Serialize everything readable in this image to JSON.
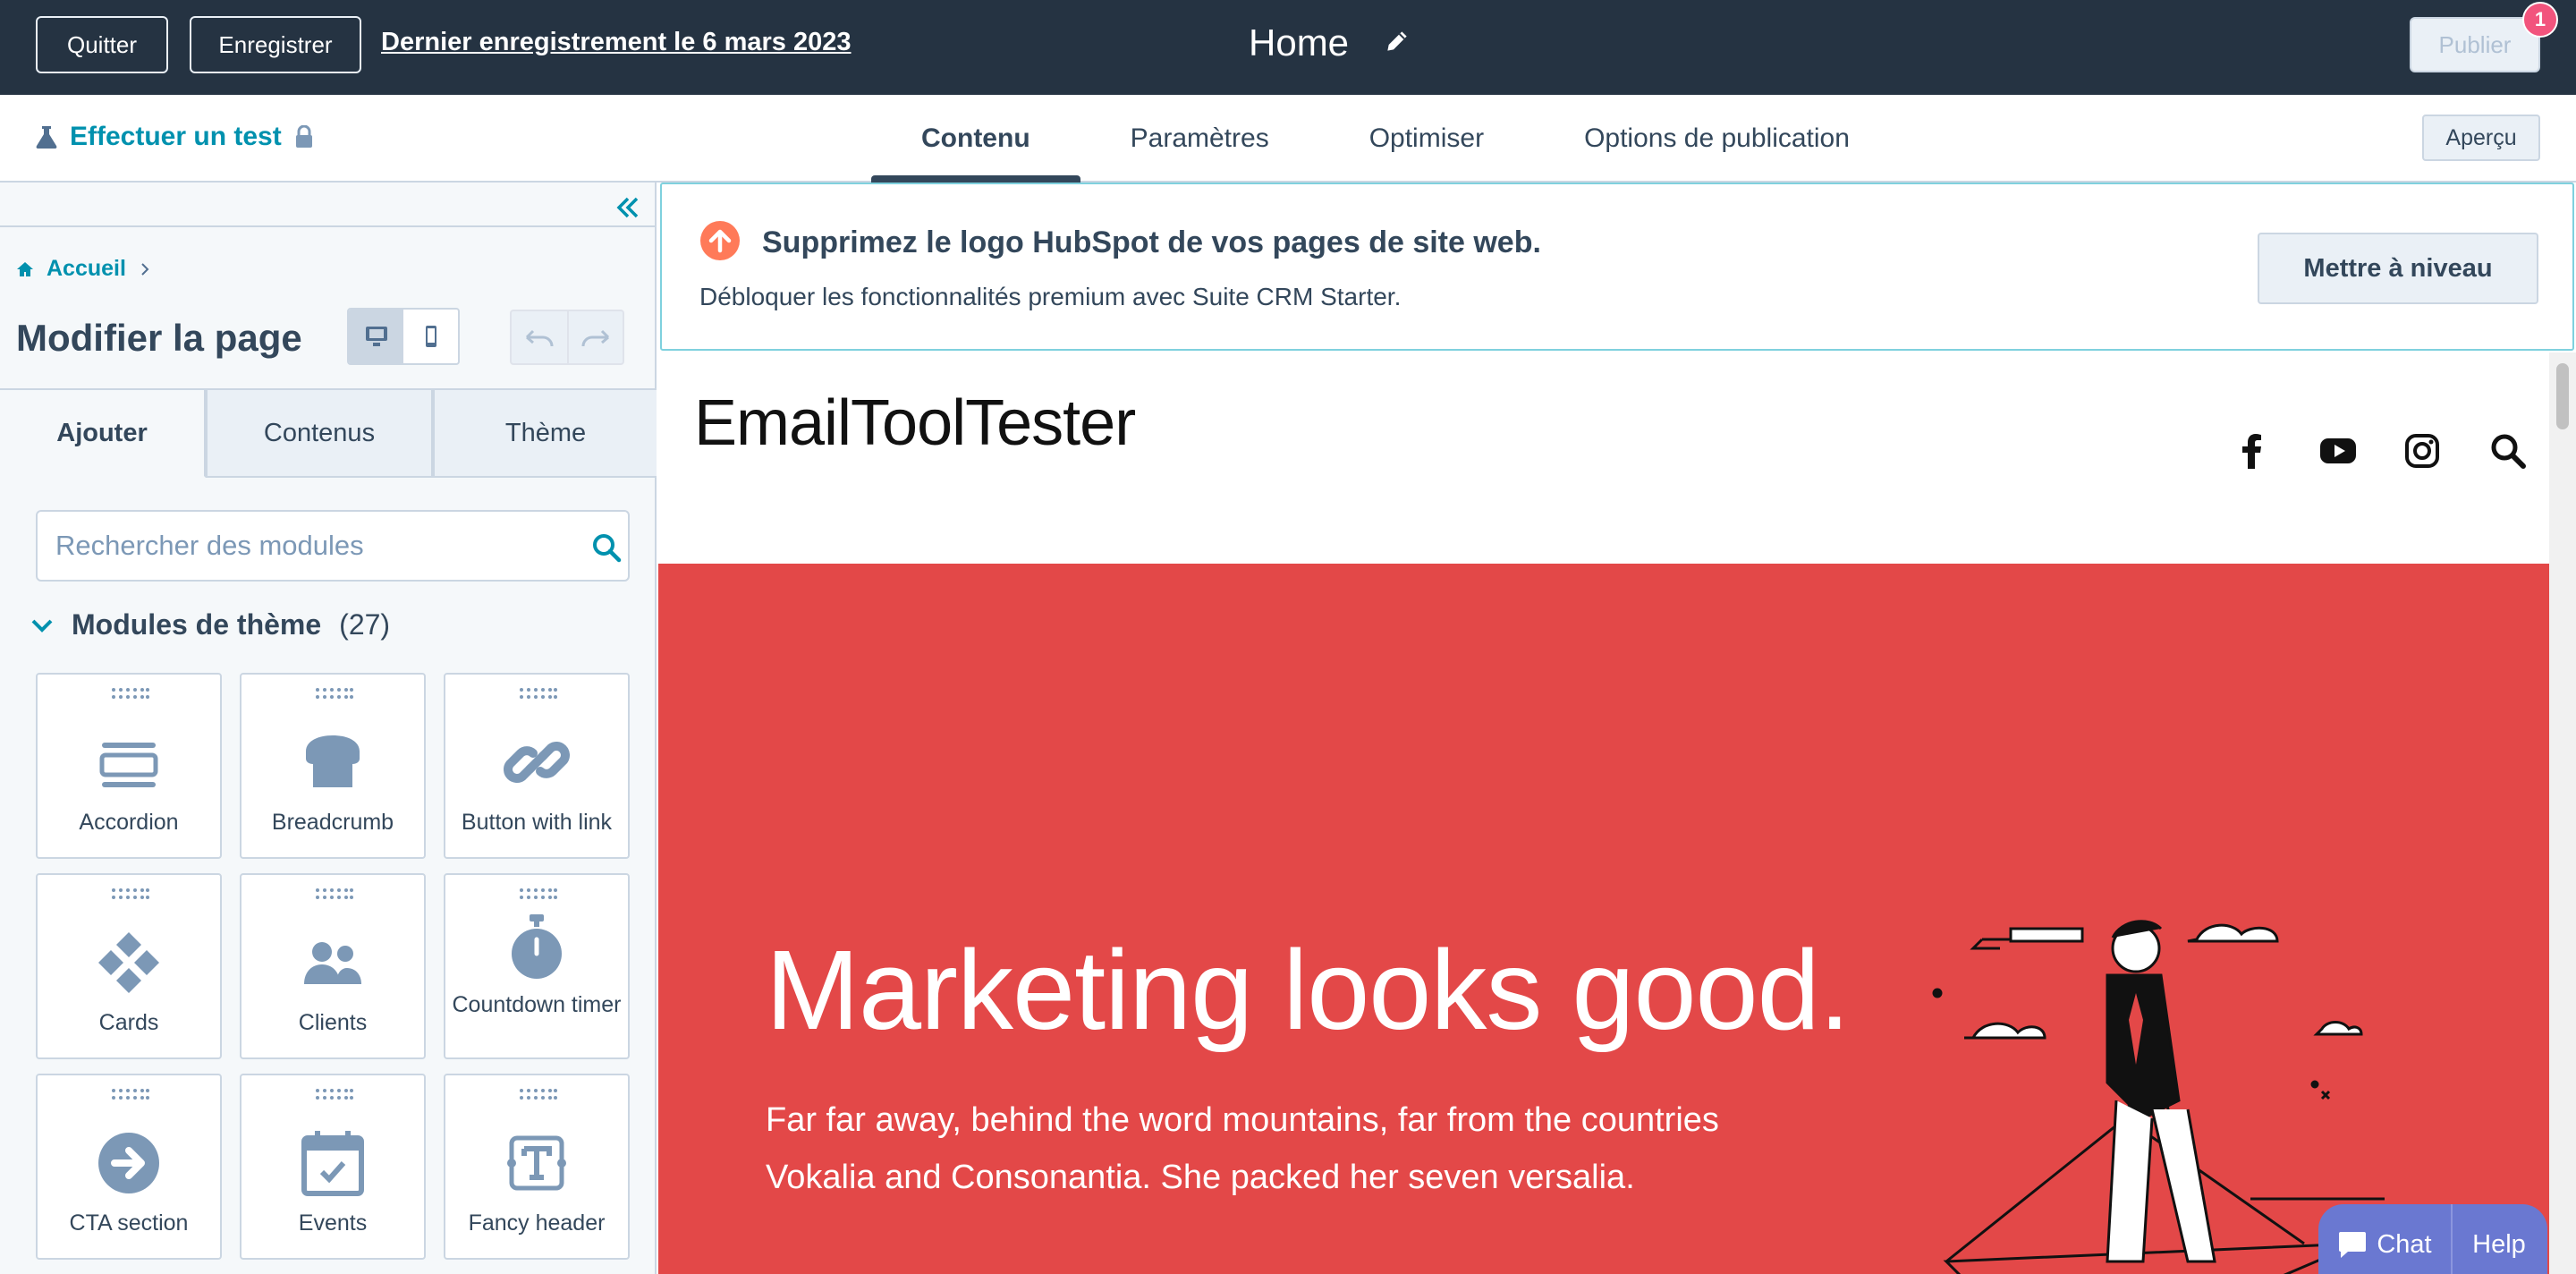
{
  "topbar": {
    "quit_label": "Quitter",
    "save_label": "Enregistrer",
    "last_saved": "Dernier enregistrement le 6 mars 2023",
    "page_title": "Home",
    "publish_label": "Publier",
    "publish_badge": "1"
  },
  "subbar": {
    "test_label": "Effectuer un test",
    "tabs": [
      "Contenu",
      "Paramètres",
      "Optimiser",
      "Options de publication"
    ],
    "active_tab": "Contenu",
    "preview_label": "Aperçu"
  },
  "sidebar": {
    "breadcrumb": "Accueil",
    "title": "Modifier la page",
    "tabs": [
      "Ajouter",
      "Contenus",
      "Thème"
    ],
    "active_tab": "Ajouter",
    "search_placeholder": "Rechercher des modules",
    "section_name": "Modules de thème",
    "section_count": "(27)",
    "modules": [
      {
        "label": "Accordion",
        "icon": "accordion-icon"
      },
      {
        "label": "Breadcrumb",
        "icon": "breadcrumb-icon"
      },
      {
        "label": "Button with link",
        "icon": "link-icon"
      },
      {
        "label": "Cards",
        "icon": "cards-icon"
      },
      {
        "label": "Clients",
        "icon": "clients-icon"
      },
      {
        "label": "Countdown timer",
        "icon": "stopwatch-icon"
      },
      {
        "label": "CTA section",
        "icon": "arrow-right-circle-icon"
      },
      {
        "label": "Events",
        "icon": "calendar-icon"
      },
      {
        "label": "Fancy header",
        "icon": "text-icon"
      }
    ]
  },
  "banner": {
    "title": "Supprimez le logo HubSpot de vos pages de site web.",
    "subtitle": "Débloquer les fonctionnalités premium avec Suite CRM Starter.",
    "upgrade_label": "Mettre à niveau"
  },
  "site": {
    "logo": "EmailToolTester",
    "social_icons": [
      "facebook-icon",
      "youtube-icon",
      "instagram-icon",
      "search-icon"
    ],
    "hero_title": "Marketing looks good.",
    "hero_text_line1": "Far far away, behind the word mountains, far from the countries",
    "hero_text_line2": "Vokalia and Consonantia. She packed her seven versalia.",
    "hero_color": "#e34848"
  },
  "chat": {
    "chat_label": "Chat",
    "help_label": "Help"
  },
  "colors": {
    "topbar_bg": "#253342",
    "link": "#0091ae",
    "text": "#33475b",
    "badge": "#f2547d",
    "chat": "#6a78d1"
  }
}
